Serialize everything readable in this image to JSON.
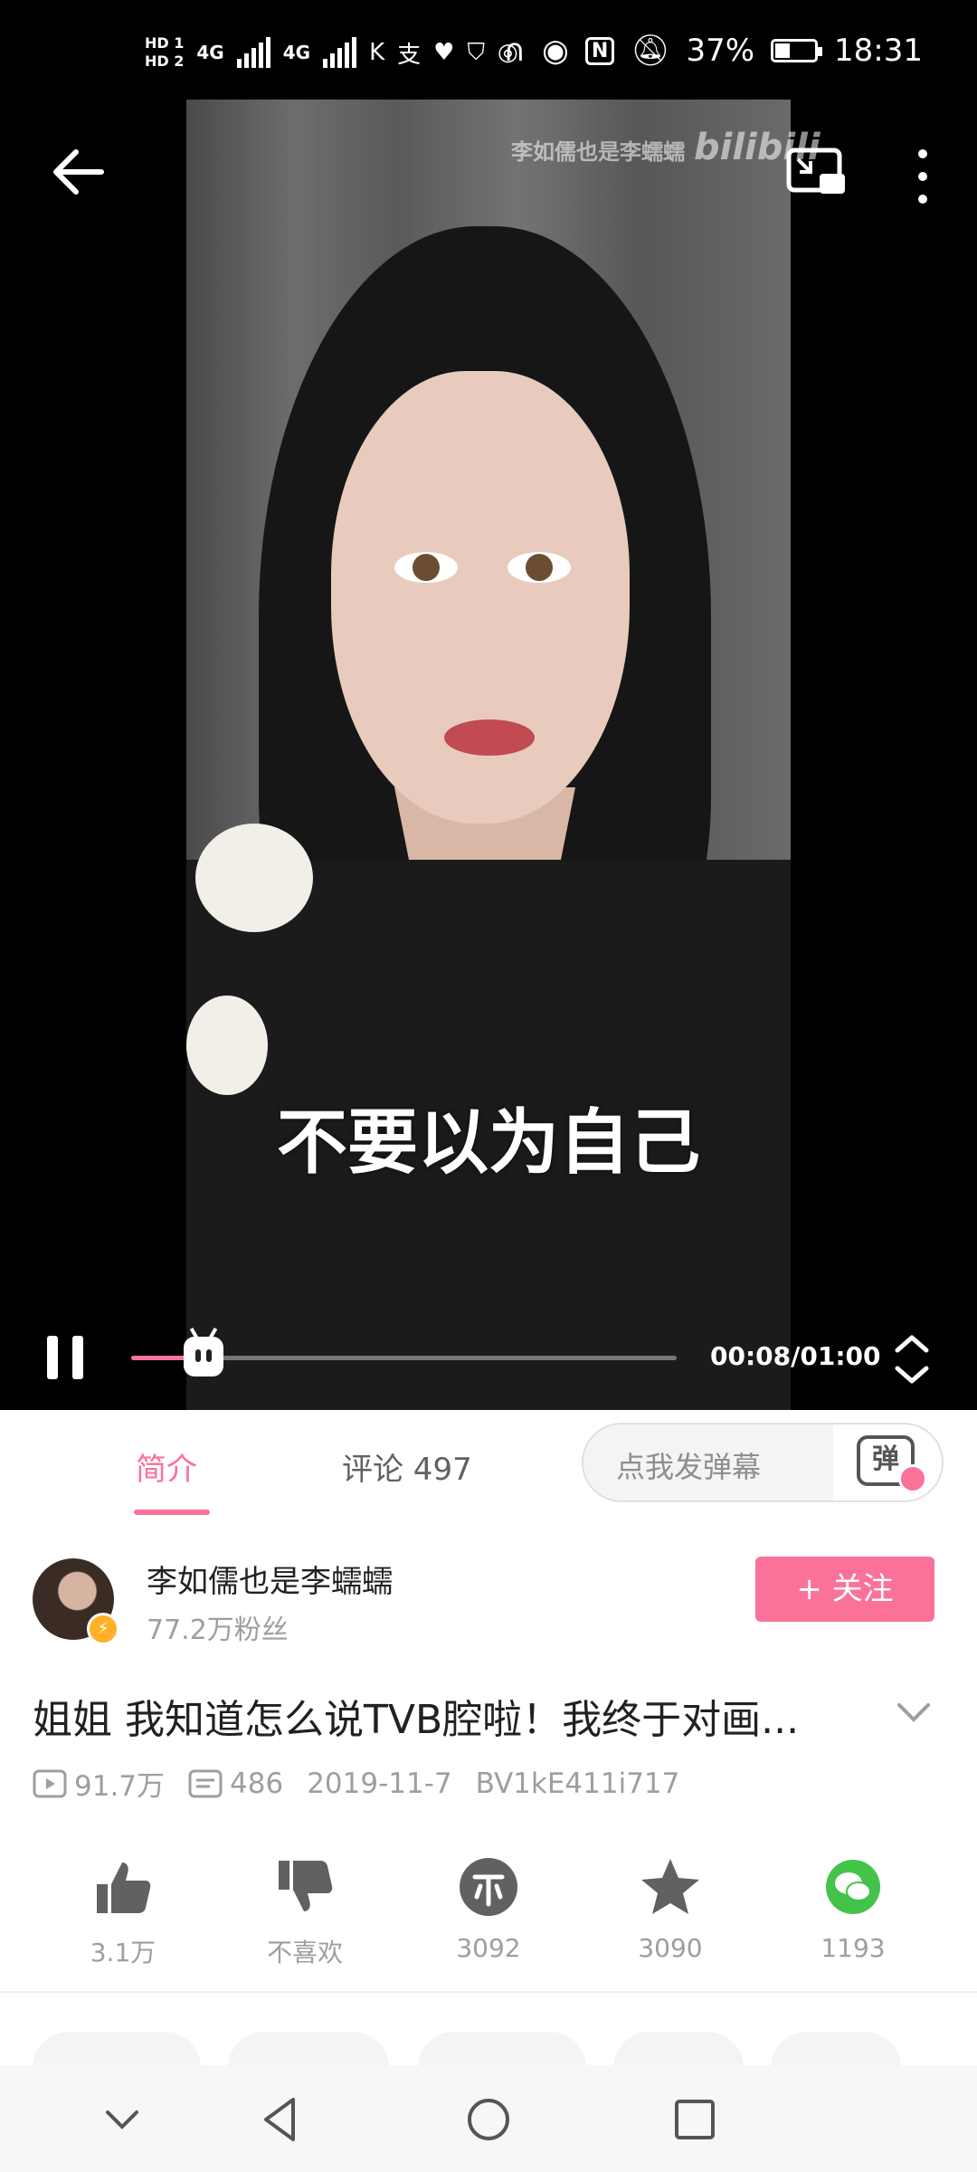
{
  "status_bar": {
    "hd1": "HD 1",
    "hd2": "HD 2",
    "net1": "4G",
    "net2": "4G",
    "battery": "37%",
    "time": "18:31"
  },
  "video": {
    "watermark_name": "李如儒也是李蠕蠕",
    "watermark_logo": "bilibili",
    "subtitle": "不要以为自己",
    "elapsed_time": "00:08/01:00",
    "progress": 0.133
  },
  "tabs": {
    "intro": "简介",
    "comments": "评论 497",
    "danmaku_placeholder": "点我发弹幕",
    "danmaku_icon_text": "弹"
  },
  "author": {
    "name": "李如儒也是李蠕蠕",
    "fans": "77.2万粉丝",
    "follow_label": "+ 关注"
  },
  "video_info": {
    "title": "姐姐 我知道怎么说TVB腔啦！我终于对画...",
    "views": "91.7万",
    "danmaku_count": "486",
    "date": "2019-11-7",
    "bvid": "BV1kE411i717"
  },
  "actions": {
    "like": "3.1万",
    "dislike": "不喜欢",
    "coin": "3092",
    "favorite": "3090",
    "share": "1193"
  },
  "colors": {
    "accent": "#fb7299",
    "wechat": "#43c34a"
  }
}
